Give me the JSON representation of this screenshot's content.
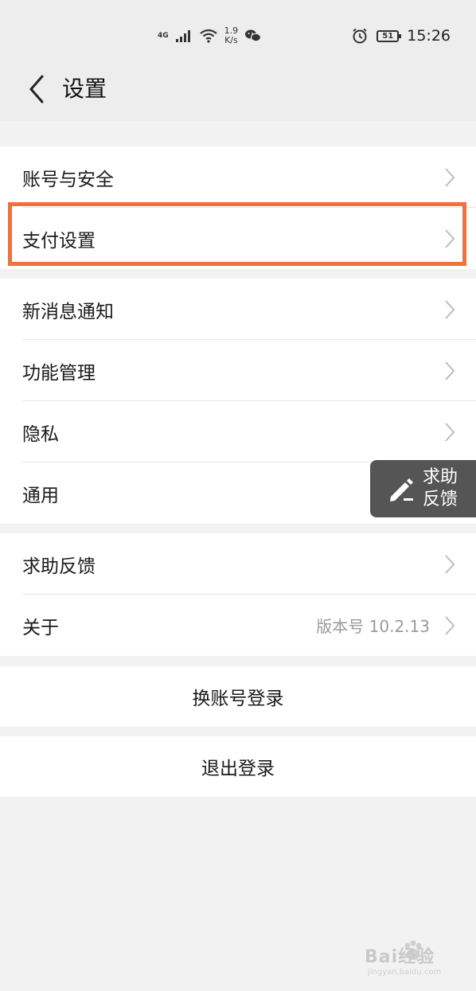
{
  "status_bar": {
    "network_type": "4G",
    "speed_value": "1.9",
    "speed_unit": "K/s",
    "battery": "51",
    "time": "15:26",
    "icons": [
      "signal-icon",
      "wifi-icon",
      "wechat-icon",
      "alarm-icon",
      "battery-icon"
    ]
  },
  "nav": {
    "title": "设置",
    "back_icon": "chevron-left-icon"
  },
  "groups": [
    {
      "items": [
        {
          "label": "账号与安全"
        },
        {
          "label": "支付设置",
          "highlighted": true
        }
      ]
    },
    {
      "items": [
        {
          "label": "新消息通知"
        },
        {
          "label": "功能管理"
        },
        {
          "label": "隐私"
        },
        {
          "label": "通用"
        }
      ]
    },
    {
      "items": [
        {
          "label": "求助反馈"
        },
        {
          "label": "关于",
          "value": "版本号 10.2.13"
        }
      ]
    }
  ],
  "actions": {
    "switch_account": "换账号登录",
    "logout": "退出登录"
  },
  "floating_help": {
    "line1": "求助",
    "line2": "反馈",
    "icon": "pencil-icon"
  },
  "watermark": {
    "logo": "Bai经验",
    "sub": "jingyan.baidu.com"
  },
  "colors": {
    "highlight": "#f0703f",
    "background": "#f2f2f2",
    "float_bg": "#555555"
  }
}
